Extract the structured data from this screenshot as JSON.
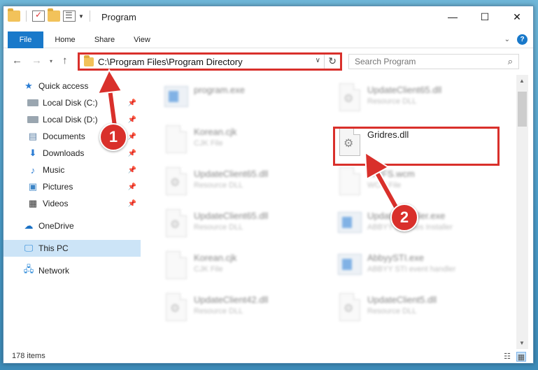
{
  "window": {
    "title": "Program",
    "controls": {
      "minimize": "—",
      "maximize": "☐",
      "close": "✕"
    }
  },
  "ribbon": {
    "tabs": [
      "File",
      "Home",
      "Share",
      "View"
    ]
  },
  "nav": {
    "back": "←",
    "forward": "→",
    "recent": "▾",
    "up": "↑",
    "address_path": "C:\\Program Files\\Program Directory",
    "search_placeholder": "Search Program"
  },
  "sidebar": {
    "items": [
      {
        "label": "Quick access",
        "icon": "star-icon",
        "pinned": false
      },
      {
        "label": "Local Disk (C:)",
        "icon": "disk-icon",
        "pinned": true
      },
      {
        "label": "Local Disk (D:)",
        "icon": "disk-icon",
        "pinned": true
      },
      {
        "label": "Documents",
        "icon": "documents-icon",
        "pinned": true
      },
      {
        "label": "Downloads",
        "icon": "downloads-icon",
        "pinned": true
      },
      {
        "label": "Music",
        "icon": "music-icon",
        "pinned": true
      },
      {
        "label": "Pictures",
        "icon": "pictures-icon",
        "pinned": true
      },
      {
        "label": "Videos",
        "icon": "videos-icon",
        "pinned": true
      },
      {
        "label": "OneDrive",
        "icon": "onedrive-icon",
        "pinned": false
      },
      {
        "label": "This PC",
        "icon": "this-pc-icon",
        "pinned": false,
        "selected": true
      },
      {
        "label": "Network",
        "icon": "network-icon",
        "pinned": false
      }
    ]
  },
  "files": [
    {
      "name": "program.exe",
      "type": "",
      "icon": "exe-icon"
    },
    {
      "name": "UpdateClient65.dll",
      "type": "Resource DLL",
      "icon": "dll-icon"
    },
    {
      "name": "Korean.cjk",
      "type": "CJK File",
      "icon": "file-icon"
    },
    {
      "name": "Gridres.dll",
      "type": "",
      "icon": "dll-icon",
      "highlighted": true
    },
    {
      "name": "UpdateClient65.dll",
      "type": "Resource DLL",
      "icon": "dll-icon"
    },
    {
      "name": "WPFS.wcm",
      "type": "WCM File",
      "icon": "file-icon"
    },
    {
      "name": "UpdateClient65.dll",
      "type": "Resource DLL",
      "icon": "dll-icon"
    },
    {
      "name": "UpdateInstaller.exe",
      "type": "ABBYY Updates Installer",
      "icon": "exe-icon"
    },
    {
      "name": "Korean.cjk",
      "type": "CJK File",
      "icon": "file-icon"
    },
    {
      "name": "AbbyySTI.exe",
      "type": "ABBYY STI event handler",
      "icon": "exe-icon"
    },
    {
      "name": "UpdateClient42.dll",
      "type": "Resource DLL",
      "icon": "dll-icon"
    },
    {
      "name": "UpdateClient5.dll",
      "type": "Resource DLL",
      "icon": "dll-icon"
    }
  ],
  "status": {
    "item_count": "178 items"
  },
  "annotations": {
    "marker_1": "1",
    "marker_2": "2"
  },
  "colors": {
    "accent": "#1979ca",
    "highlight": "#d9302b",
    "selection": "#cce4f7"
  }
}
